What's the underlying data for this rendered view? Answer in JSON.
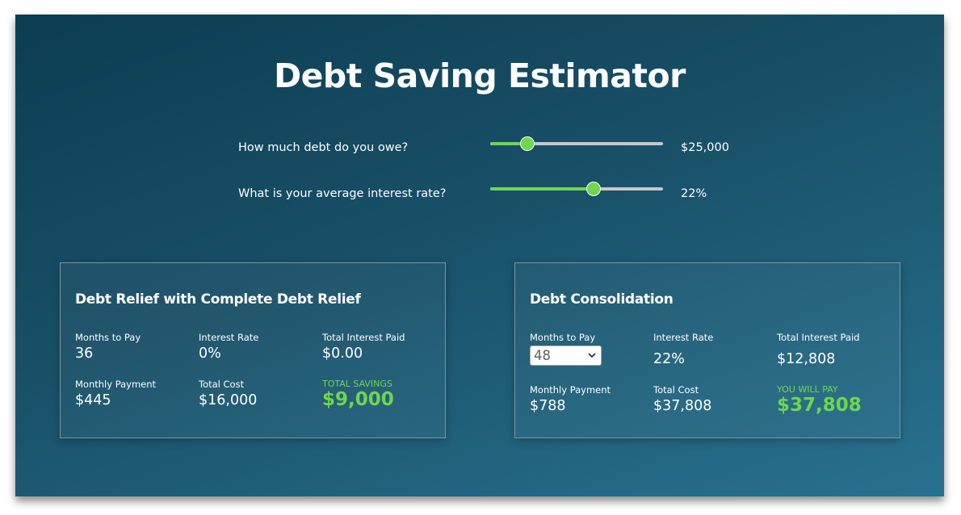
{
  "title": "Debt Saving Estimator",
  "controls": {
    "debt": {
      "label": "How much debt do you owe?",
      "value_text": "$25,000",
      "level": 0.215
    },
    "rate": {
      "label": "What is your average interest rate?",
      "value_text": "22%",
      "level": 0.6
    }
  },
  "colors": {
    "accent": "#6fd64e",
    "track": "#c8c8c8",
    "panel": "#195068"
  },
  "relief": {
    "title": "Debt Relief with Complete Debt Relief",
    "months_label": "Months to Pay",
    "months_value": "36",
    "rate_label": "Interest Rate",
    "rate_value": "0%",
    "interest_label": "Total Interest Paid",
    "interest_value": "$0.00",
    "monthly_label": "Monthly Payment",
    "monthly_value": "$445",
    "cost_label": "Total Cost",
    "cost_value": "$16,000",
    "savings_label": "TOTAL SAVINGS",
    "savings_value": "$9,000"
  },
  "consolidation": {
    "title": "Debt Consolidation",
    "months_label": "Months to Pay",
    "months_selected": "48",
    "rate_label": "Interest Rate",
    "rate_value": "22%",
    "interest_label": "Total Interest Paid",
    "interest_value": "$12,808",
    "monthly_label": "Monthly Payment",
    "monthly_value": "$788",
    "cost_label": "Total Cost",
    "cost_value": "$37,808",
    "pay_label": "YOU WILL PAY",
    "pay_value": "$37,808"
  }
}
